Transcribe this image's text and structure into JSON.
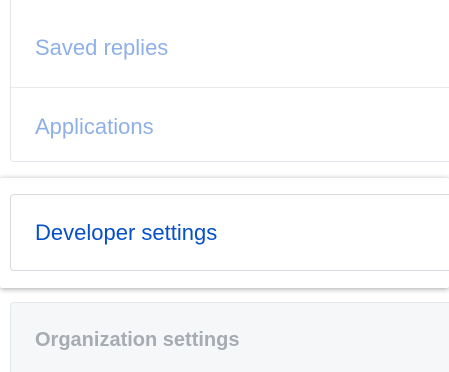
{
  "menu": {
    "items": [
      {
        "label": "Saved replies"
      },
      {
        "label": "Applications"
      }
    ]
  },
  "developer": {
    "label": "Developer settings"
  },
  "organization": {
    "header": "Organization settings"
  },
  "colors": {
    "link_faded": "#8fb0e6",
    "link_active": "#0650c8",
    "muted_header": "#a7acb2",
    "panel_bg": "#f5f7f9"
  }
}
